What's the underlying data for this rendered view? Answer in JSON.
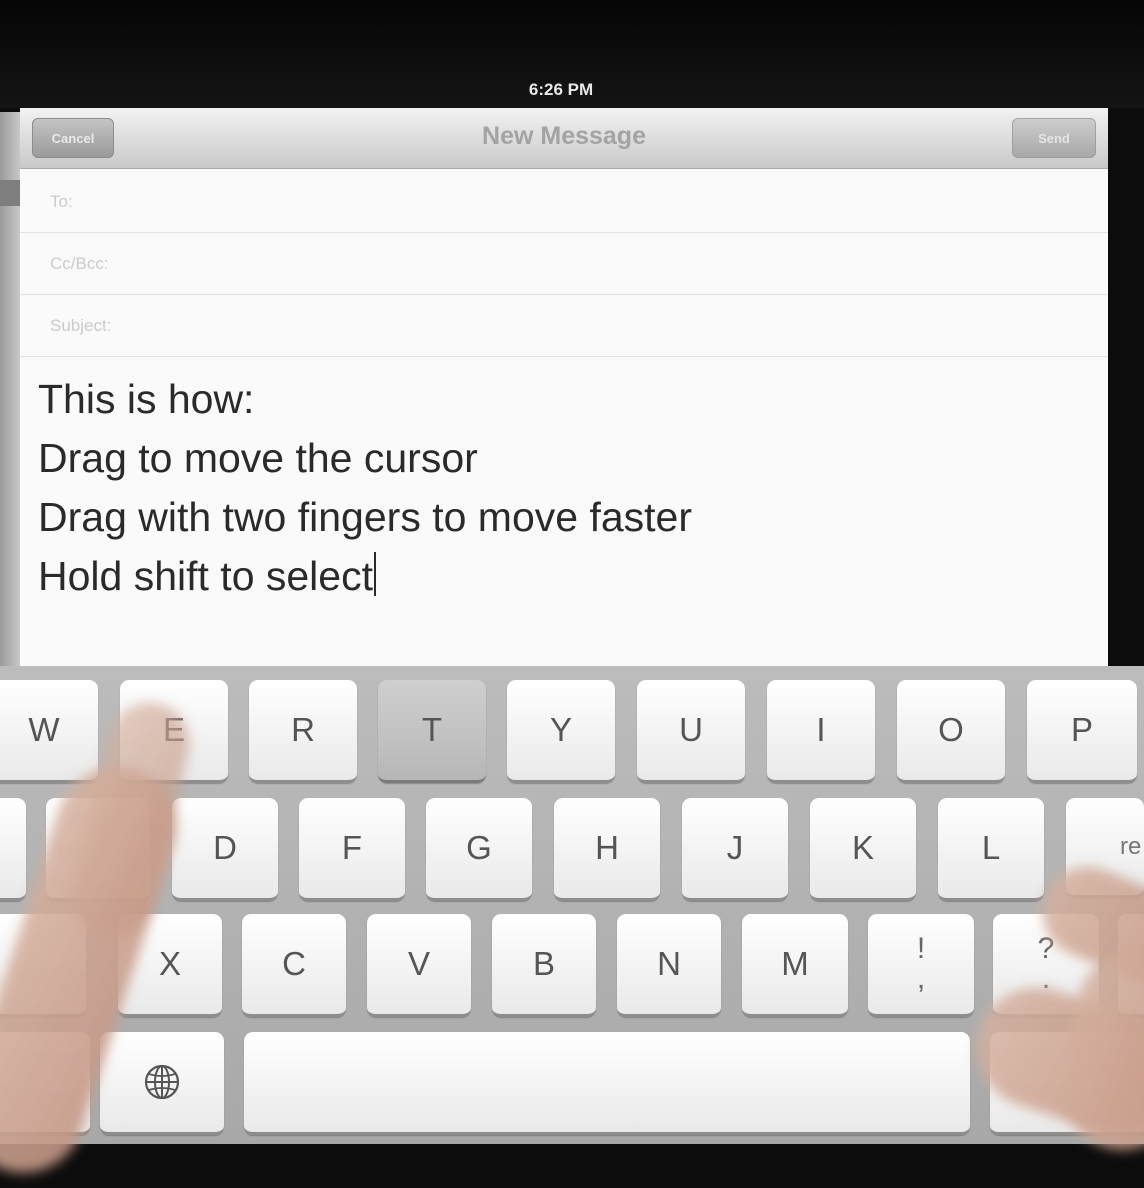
{
  "status": {
    "time": "6:26 PM"
  },
  "nav": {
    "title": "New Message",
    "cancel": "Cancel",
    "send": "Send"
  },
  "fields": {
    "to": "To:",
    "ccbcc": "Cc/Bcc:",
    "subject": "Subject:"
  },
  "message_lines": [
    "This is how:",
    "Drag to move the cursor",
    "Drag with two fingers to move faster",
    "Hold shift to select"
  ],
  "keyboard": {
    "row1": [
      "W",
      "E",
      "R",
      "T",
      "Y",
      "U",
      "I",
      "O",
      "P"
    ],
    "row2": [
      "D",
      "F",
      "G",
      "H",
      "J",
      "K",
      "L"
    ],
    "return_partial": "re",
    "row3": [
      "X",
      "C",
      "V",
      "B",
      "N",
      "M"
    ],
    "punct1": {
      "top": "!",
      "bottom": ","
    },
    "punct2": {
      "top": "?",
      "bottom": "."
    },
    "globe_icon": "globe-icon",
    "pressed_key": "T"
  }
}
